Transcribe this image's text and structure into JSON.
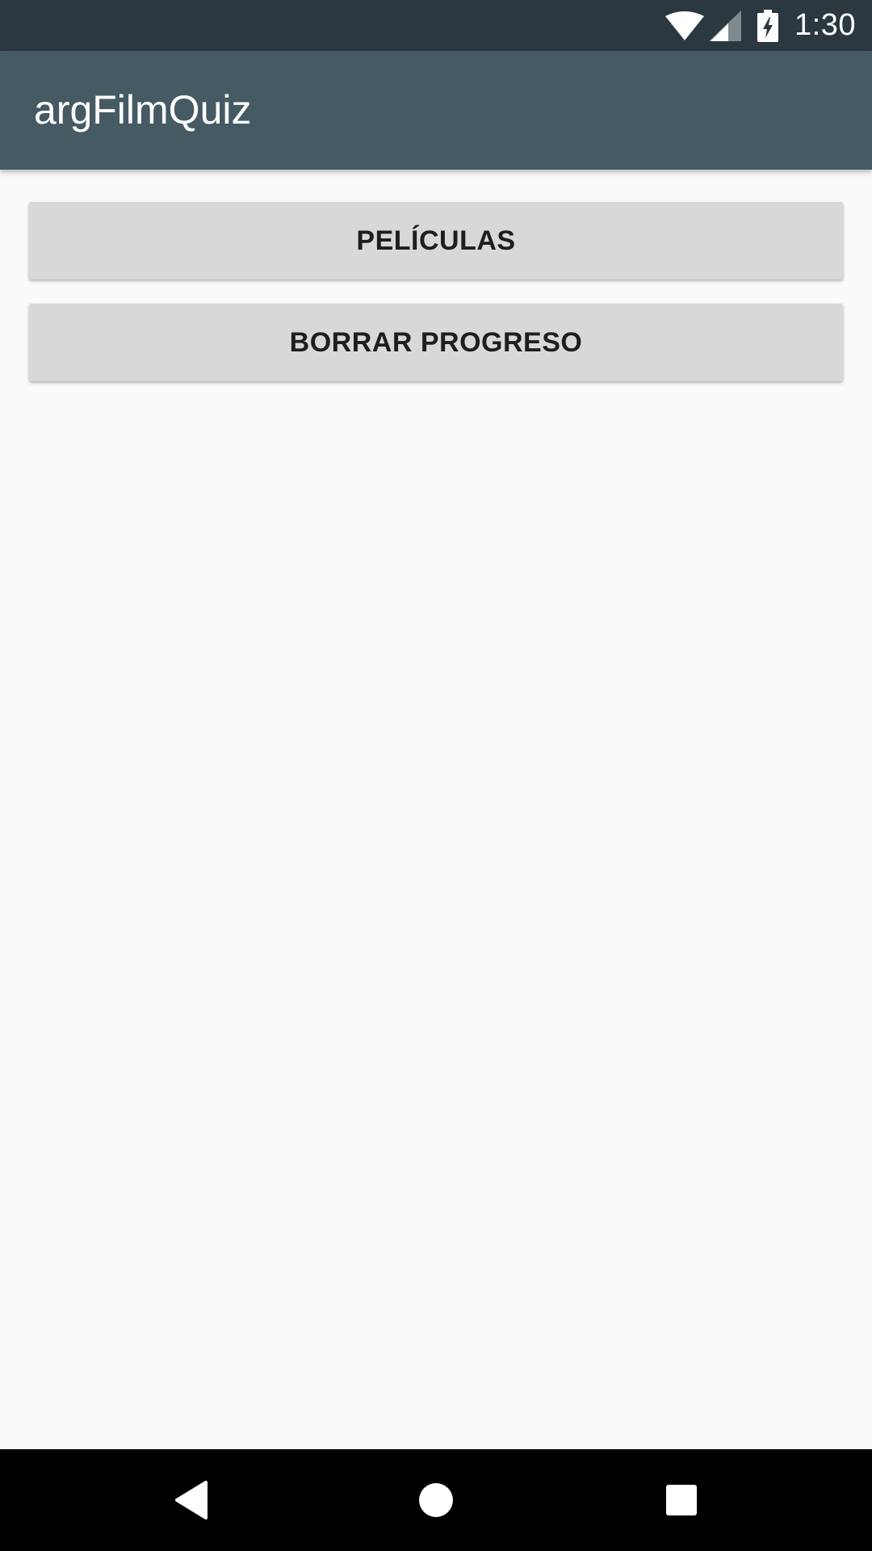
{
  "status_bar": {
    "time": "1:30",
    "icons": [
      "wifi-icon",
      "cell-signal-icon",
      "battery-charging-icon"
    ],
    "background": "#2c383f"
  },
  "app_bar": {
    "title": "argFilmQuiz",
    "background": "#465a64"
  },
  "main": {
    "buttons": [
      {
        "label": "PELÍCULAS"
      },
      {
        "label": "BORRAR PROGRESO"
      }
    ],
    "background": "#fafafa",
    "button_color": "#d7d8d8"
  },
  "nav_bar": {
    "buttons": [
      "back-icon",
      "home-icon",
      "recents-icon"
    ],
    "background": "#000000"
  }
}
